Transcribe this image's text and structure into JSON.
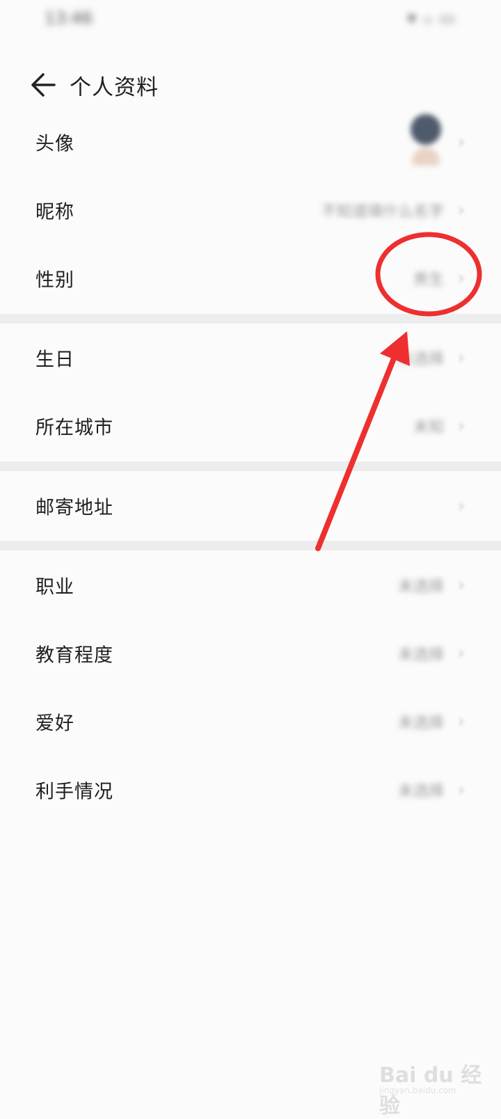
{
  "status_bar": {
    "time": "13:46",
    "icons": "▾ ᵢₗ ▭"
  },
  "header": {
    "title": "个人资料"
  },
  "rows": [
    {
      "label": "头像",
      "value": ""
    },
    {
      "label": "昵称",
      "value": "不知道填什么名字"
    },
    {
      "label": "性别",
      "value": "男生"
    },
    {
      "label": "生日",
      "value": "未选择"
    },
    {
      "label": "所在城市",
      "value": "未知"
    },
    {
      "label": "邮寄地址",
      "value": ""
    },
    {
      "label": "职业",
      "value": "未选择"
    },
    {
      "label": "教育程度",
      "value": "未选择"
    },
    {
      "label": "爱好",
      "value": "未选择"
    },
    {
      "label": "利手情况",
      "value": "未选择"
    }
  ],
  "chevron": "›",
  "annotation": {
    "color": "#ee2f2f"
  },
  "watermark": {
    "text": "Bai du 经验",
    "sub": "jingyan.baidu.com"
  },
  "icons": {
    "back": "arrow-left-icon",
    "chevron": "chevron-right-icon",
    "avatar": "user-avatar"
  }
}
